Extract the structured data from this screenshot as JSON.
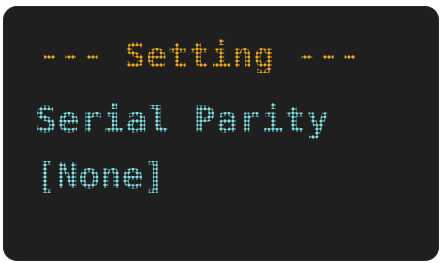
{
  "screen": {
    "title": "--- Setting ---",
    "parameter_name": "Serial Parity",
    "parameter_value": "[None]"
  },
  "colors": {
    "background": "#1f1f1f",
    "title_text": "#f0a81c",
    "body_text": "#7fe0e6"
  }
}
